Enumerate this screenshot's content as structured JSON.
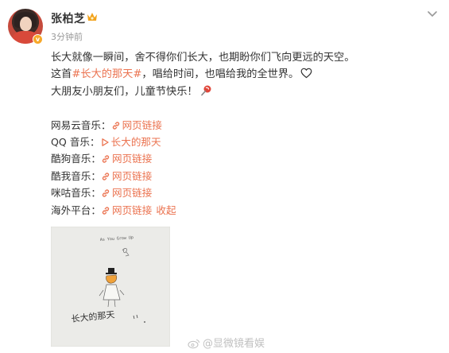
{
  "header": {
    "username": "张柏芝",
    "time": "3分钟前",
    "badge": "v"
  },
  "post": {
    "line1": "长大就像一瞬间，舍不得你们长大，也期盼你们飞向更远的天空。",
    "line2_prefix": "这首",
    "line2_topic": "#长大的那天#",
    "line2_suffix": "，唱给时间，也唱给我的全世界。",
    "line3": "大朋友小朋友们，儿童节快乐！"
  },
  "sources": [
    {
      "label": "网易云音乐：",
      "link": "网页链接",
      "icon": "link-icon"
    },
    {
      "label": "QQ 音乐：",
      "link": "长大的那天",
      "icon": "play-icon"
    },
    {
      "label": "酷狗音乐：",
      "link": "网页链接",
      "icon": "link-icon"
    },
    {
      "label": "酷我音乐：",
      "link": "网页链接",
      "icon": "link-icon"
    },
    {
      "label": "咪咕音乐：",
      "link": "网页链接",
      "icon": "link-icon"
    },
    {
      "label": "海外平台：",
      "link": "网页链接",
      "collapse": "收起",
      "icon": "link-icon"
    }
  ],
  "cover": {
    "handwriting_top": "As You Grow Up",
    "handwriting_title": "长大的那天"
  },
  "watermark": "@显微镜看娱",
  "colors": {
    "accent": "#eb7350",
    "badge": "#f7a829",
    "muted": "#999999"
  }
}
